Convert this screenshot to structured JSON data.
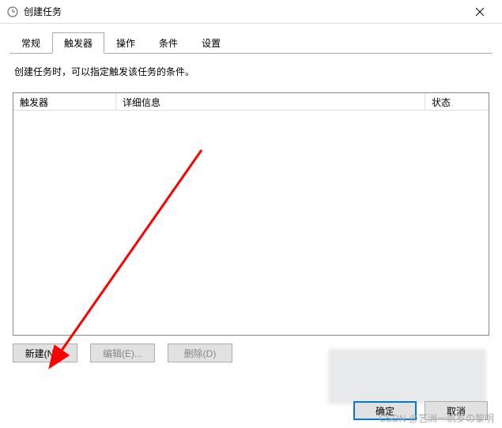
{
  "window": {
    "title": "创建任务"
  },
  "tabs": [
    {
      "label": "常规",
      "active": false
    },
    {
      "label": "触发器",
      "active": true
    },
    {
      "label": "操作",
      "active": false
    },
    {
      "label": "条件",
      "active": false
    },
    {
      "label": "设置",
      "active": false
    }
  ],
  "description": "创建任务时，可以指定触发该任务的条件。",
  "table": {
    "columns": [
      "触发器",
      "详细信息",
      "状态"
    ],
    "rows": []
  },
  "actions": {
    "new_label": "新建(N)...",
    "edit_label": "编辑(E)...",
    "delete_label": "删除(D)"
  },
  "footer": {
    "ok_label": "确定",
    "cancel_label": "取消"
  },
  "watermark": "CSDN @艺洲一帆岁の黎明"
}
